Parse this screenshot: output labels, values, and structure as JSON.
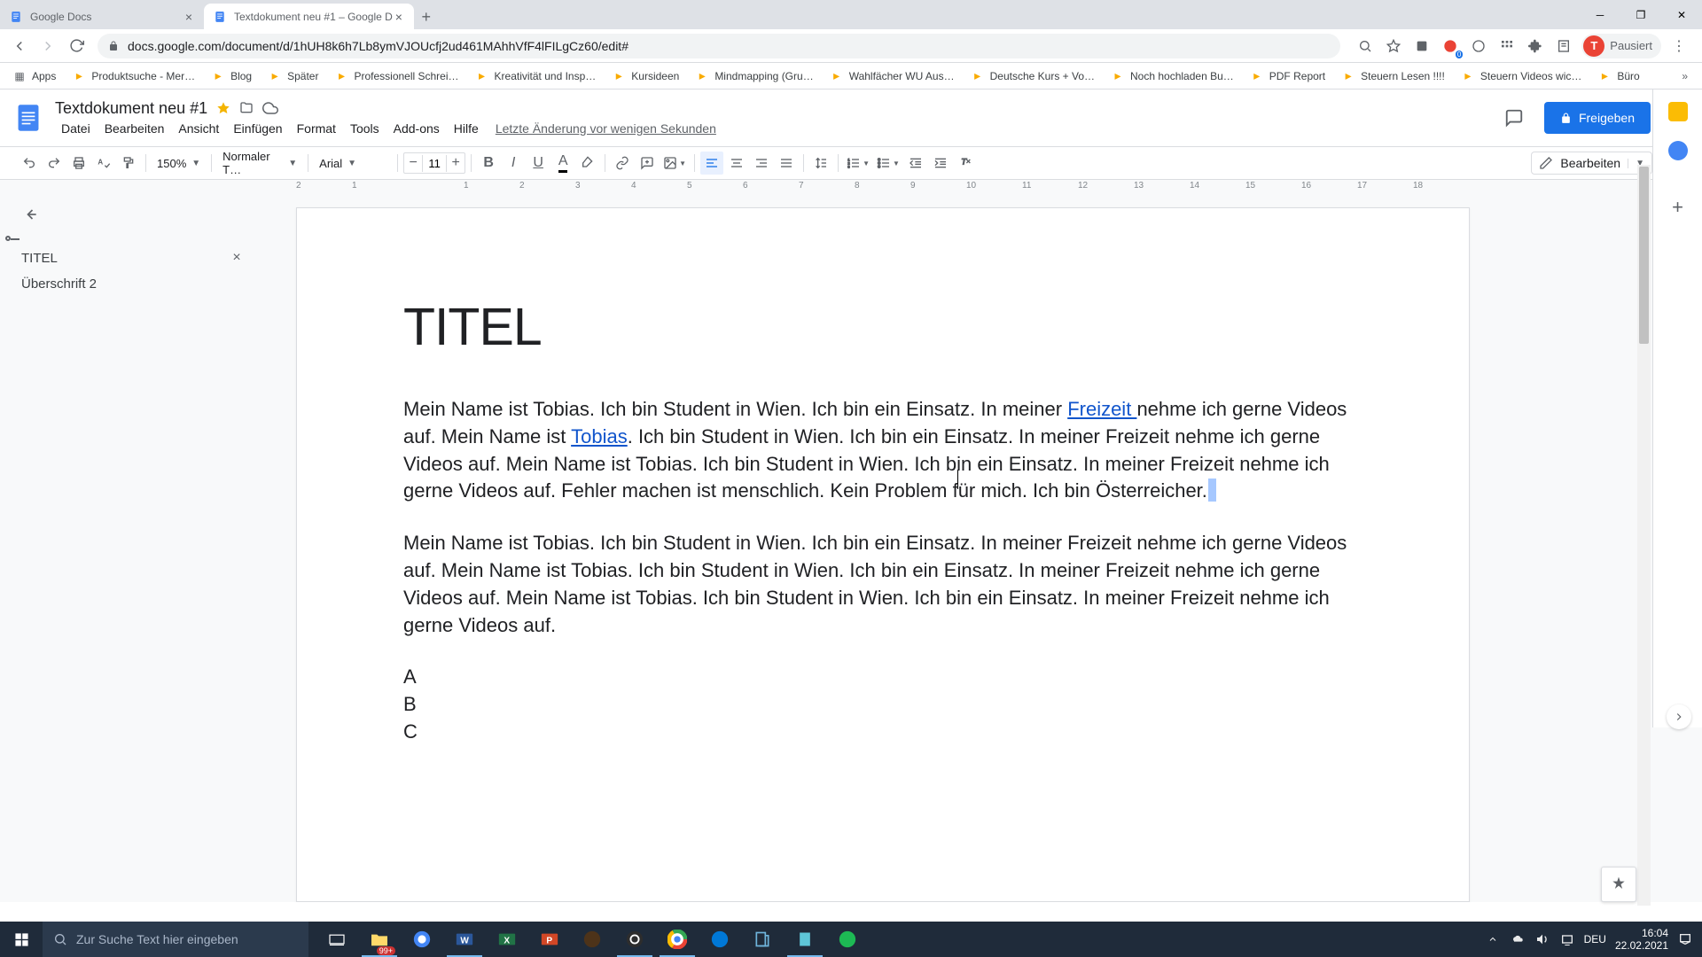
{
  "browser": {
    "tabs": [
      {
        "title": "Google Docs",
        "active": false
      },
      {
        "title": "Textdokument neu #1 – Google D",
        "active": true
      }
    ],
    "url": "docs.google.com/document/d/1hUH8k6h7Lb8ymVJOUcfj2ud461MAhhVfF4lFILgCz60/edit#",
    "profile_label": "Pausiert",
    "profile_initial": "T"
  },
  "bookmarks": [
    "Apps",
    "Produktsuche - Mer…",
    "Blog",
    "Später",
    "Professionell Schrei…",
    "Kreativität und Insp…",
    "Kursideen",
    "Mindmapping  (Gru…",
    "Wahlfächer WU Aus…",
    "Deutsche Kurs + Vo…",
    "Noch hochladen Bu…",
    "PDF Report",
    "Steuern Lesen !!!!",
    "Steuern Videos wic…",
    "Büro"
  ],
  "docs": {
    "title": "Textdokument neu #1",
    "menus": [
      "Datei",
      "Bearbeiten",
      "Ansicht",
      "Einfügen",
      "Format",
      "Tools",
      "Add-ons",
      "Hilfe"
    ],
    "last_change": "Letzte Änderung vor wenigen Sekunden",
    "share_label": "Freigeben",
    "edit_mode_label": "Bearbeiten",
    "zoom": "150%",
    "style": "Normaler T…",
    "font": "Arial",
    "font_size": "11"
  },
  "ruler": [
    "2",
    "1",
    "",
    "1",
    "2",
    "3",
    "4",
    "5",
    "6",
    "7",
    "8",
    "9",
    "10",
    "11",
    "12",
    "13",
    "14",
    "15",
    "16",
    "17",
    "18"
  ],
  "outline": {
    "title": "TITEL",
    "sub": "Überschrift 2"
  },
  "document": {
    "h1": "TITEL",
    "p1_a": "Mein Name ist Tobias. Ich bin Student in Wien. Ich bin ein Einsatz. In meiner ",
    "p1_link1": "Freizeit ",
    "p1_b": "nehme ich gerne Videos auf. Mein Name ist ",
    "p1_link2": "Tobias",
    "p1_c": ". Ich bin Student in Wien. Ich bin ein Einsatz. In meiner Freizeit nehme ich gerne Videos auf. Mein Name ist Tobias. Ich bin Student in Wien. Ich bin ein Einsatz. In meiner Freizeit nehme ich gerne Videos auf. Fehler machen ist menschlich. Kein Problem für mich. Ich bin Österreicher.",
    "p2": "Mein Name ist Tobias. Ich bin Student in Wien. Ich bin ein Einsatz. In meiner Freizeit nehme ich gerne Videos auf. Mein Name ist Tobias. Ich bin Student in Wien. Ich bin ein Einsatz. In meiner Freizeit nehme ich gerne Videos auf. Mein Name ist Tobias. Ich bin Student in Wien. Ich bin ein Einsatz. In meiner Freizeit nehme ich gerne Videos auf.",
    "list": [
      "A",
      "B",
      "C"
    ]
  },
  "taskbar": {
    "search_placeholder": "Zur Suche Text hier eingeben",
    "notify_count": "99+",
    "lang": "DEU",
    "time": "16:04",
    "date": "22.02.2021"
  }
}
